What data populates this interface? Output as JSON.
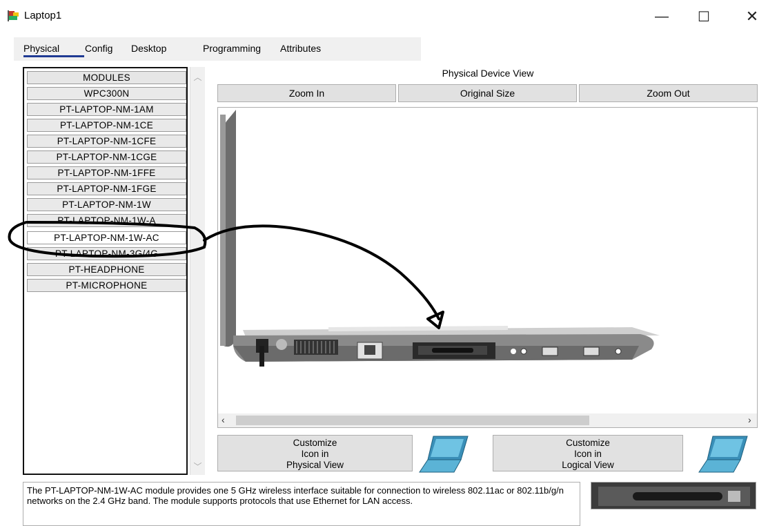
{
  "window": {
    "title": "Laptop1",
    "minimize_glyph": "—",
    "maximize_glyph": "☐",
    "close_glyph": "✕"
  },
  "tabs": [
    "Physical",
    "Config",
    "Desktop",
    "Programming",
    "Attributes"
  ],
  "active_tab": "Physical",
  "modules": {
    "header": "MODULES",
    "items": [
      "WPC300N",
      "PT-LAPTOP-NM-1AM",
      "PT-LAPTOP-NM-1CE",
      "PT-LAPTOP-NM-1CFE",
      "PT-LAPTOP-NM-1CGE",
      "PT-LAPTOP-NM-1FFE",
      "PT-LAPTOP-NM-1FGE",
      "PT-LAPTOP-NM-1W",
      "PT-LAPTOP-NM-1W-A",
      "PT-LAPTOP-NM-1W-AC",
      "PT-LAPTOP-NM-3G/4G",
      "PT-HEADPHONE",
      "PT-MICROPHONE"
    ],
    "highlighted": "PT-LAPTOP-NM-1W-AC"
  },
  "physical_view": {
    "title": "Physical Device View",
    "zoom_in": "Zoom In",
    "original_size": "Original Size",
    "zoom_out": "Zoom Out"
  },
  "customize": {
    "physical": "Customize\nIcon in\nPhysical View",
    "logical": "Customize\nIcon in\nLogical View"
  },
  "description": "The PT-LAPTOP-NM-1W-AC module provides one 5 GHz wireless interface suitable for connection to wireless 802.11ac or 802.11b/g/n networks on the 2.4 GHz band. The module supports protocols that use Ethernet for LAN access.",
  "colors": {
    "annotation": "#000000",
    "laptop_icon": "#3a8fb8",
    "tab_underline": "#1f3a93"
  }
}
